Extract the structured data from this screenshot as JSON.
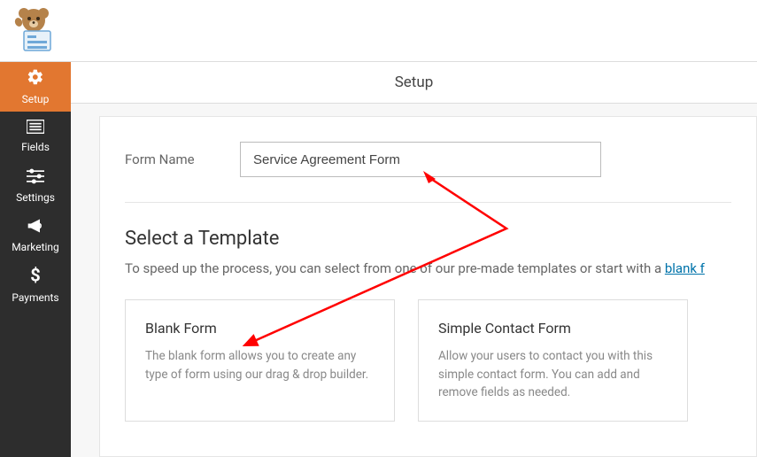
{
  "sidebar": {
    "items": [
      {
        "label": "Setup",
        "icon": "gear"
      },
      {
        "label": "Fields",
        "icon": "list"
      },
      {
        "label": "Settings",
        "icon": "sliders"
      },
      {
        "label": "Marketing",
        "icon": "megaphone"
      },
      {
        "label": "Payments",
        "icon": "dollar"
      }
    ]
  },
  "header": {
    "tab": "Setup"
  },
  "form_name": {
    "label": "Form Name",
    "value": "Service Agreement Form"
  },
  "template_section": {
    "title": "Select a Template",
    "desc_pre": "To speed up the process, you can select from one of our pre-made templates or start with a ",
    "desc_link": "blank f"
  },
  "templates": [
    {
      "title": "Blank Form",
      "desc": "The blank form allows you to create any type of form using our drag & drop builder."
    },
    {
      "title": "Simple Contact Form",
      "desc": "Allow your users to contact you with this simple contact form. You can add and remove fields as needed."
    }
  ]
}
